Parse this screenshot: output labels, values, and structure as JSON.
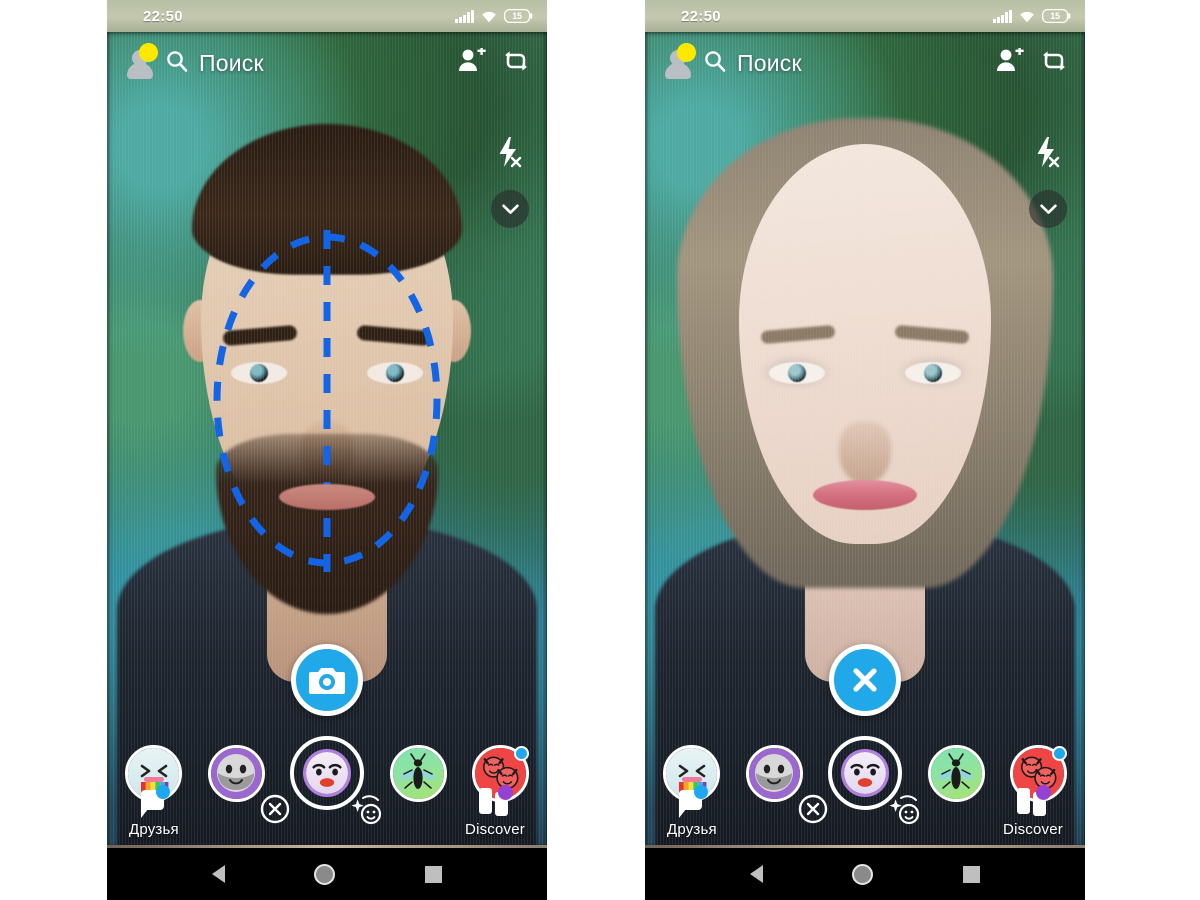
{
  "page": {
    "background": "#ffffff",
    "description": "Two Android phone screenshots of Snapchat camera, before and after gender-swap lens"
  },
  "colors": {
    "accent_blue": "#21a8e8",
    "badge_blue": "#1fa8ef",
    "badge_purple": "#9542d4",
    "avatar_yellow": "#ffe800",
    "detect_oval": "#1464e6",
    "white": "#ffffff",
    "nav_black": "#000000"
  },
  "phones": [
    {
      "id": "left",
      "status_bar": {
        "time": "22:50",
        "signal_icon": "cell-signal-icon",
        "wifi_icon": "wifi-icon",
        "battery_icon": "battery-icon",
        "battery_level": "15"
      },
      "top_bar": {
        "avatar_icon": "profile-avatar-icon",
        "search_icon": "search-icon",
        "search_label": "Поиск",
        "add_friend_icon": "add-friend-icon",
        "flip_camera_icon": "flip-camera-icon"
      },
      "camera_controls": {
        "flash_icon": "flash-off-icon",
        "chevron_icon": "chevron-down-icon"
      },
      "face_detect": {
        "visible": true,
        "shape": "dashed-oval-with-crosshair",
        "color": "#1464e6"
      },
      "shutter": {
        "icon": "camera-shutter-icon",
        "mode": "capture",
        "color": "#21a8e8"
      },
      "lenses": [
        {
          "name": "rainbow-puke-lens",
          "selected": false,
          "badge": null
        },
        {
          "name": "gender-swap-male-lens",
          "selected": false,
          "badge": null
        },
        {
          "name": "gender-swap-female-lens",
          "selected": true,
          "badge": null
        },
        {
          "name": "fly-lens",
          "selected": false,
          "badge": null
        },
        {
          "name": "red-devil-faces-lens",
          "selected": false,
          "badge": "#1fa8ef"
        }
      ],
      "bottom_nav": {
        "friends_icon": "chat-bubble-icon",
        "friends_label": "Друзья",
        "friends_badge": "#1fa8ef",
        "close_icon": "close-circle-icon",
        "lens_explorer_icon": "sparkle-smiley-icon",
        "discover_icon": "discover-cards-icon",
        "discover_label": "Discover",
        "discover_badge": "#9542d4"
      },
      "android_nav": {
        "back_icon": "back-triangle-icon",
        "home_icon": "home-circle-icon",
        "recents_icon": "recents-square-icon"
      }
    },
    {
      "id": "right",
      "status_bar": {
        "time": "22:50",
        "signal_icon": "cell-signal-icon",
        "wifi_icon": "wifi-icon",
        "battery_icon": "battery-icon",
        "battery_level": "15"
      },
      "top_bar": {
        "avatar_icon": "profile-avatar-icon",
        "search_icon": "search-icon",
        "search_label": "Поиск",
        "add_friend_icon": "add-friend-icon",
        "flip_camera_icon": "flip-camera-icon"
      },
      "camera_controls": {
        "flash_icon": "flash-off-icon",
        "chevron_icon": "chevron-down-icon"
      },
      "face_detect": {
        "visible": false,
        "shape": "dashed-oval-with-crosshair",
        "color": "#1464e6"
      },
      "shutter": {
        "icon": "close-x-icon",
        "mode": "close",
        "color": "#21a8e8"
      },
      "lenses": [
        {
          "name": "rainbow-puke-lens",
          "selected": false,
          "badge": null
        },
        {
          "name": "gender-swap-male-lens",
          "selected": false,
          "badge": null
        },
        {
          "name": "gender-swap-female-lens",
          "selected": true,
          "badge": null
        },
        {
          "name": "fly-lens",
          "selected": false,
          "badge": null
        },
        {
          "name": "red-devil-faces-lens",
          "selected": false,
          "badge": "#1fa8ef"
        }
      ],
      "bottom_nav": {
        "friends_icon": "chat-bubble-icon",
        "friends_label": "Друзья",
        "friends_badge": "#1fa8ef",
        "close_icon": "close-circle-icon",
        "lens_explorer_icon": "sparkle-smiley-icon",
        "discover_icon": "discover-cards-icon",
        "discover_label": "Discover",
        "discover_badge": "#9542d4"
      },
      "android_nav": {
        "back_icon": "back-triangle-icon",
        "home_icon": "home-circle-icon",
        "recents_icon": "recents-square-icon"
      }
    }
  ]
}
